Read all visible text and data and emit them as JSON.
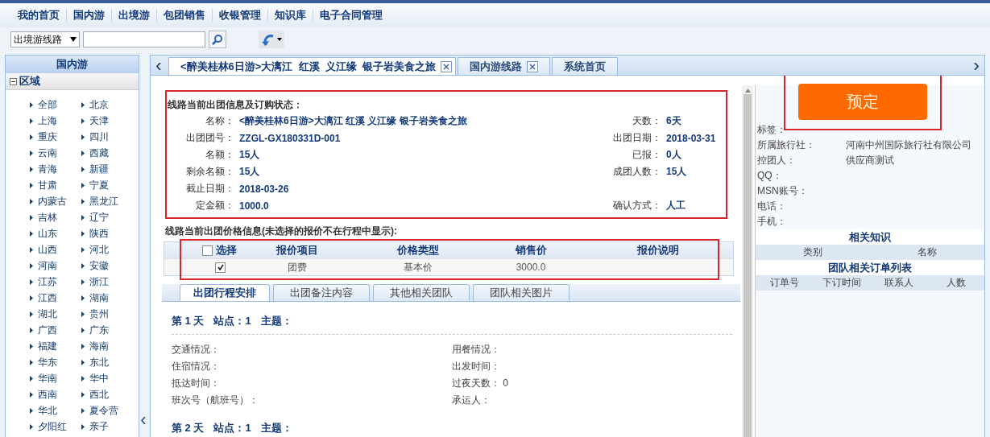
{
  "menu": [
    "我的首页",
    "国内游",
    "出境游",
    "包团销售",
    "收银管理",
    "知识库",
    "电子合同管理"
  ],
  "toolbar": {
    "select": "出境游线路"
  },
  "sidebar": {
    "title": "国内游",
    "section": {
      "label": "区域",
      "expanded": true
    },
    "items": [
      "全部",
      "北京",
      "上海",
      "天津",
      "重庆",
      "四川",
      "云南",
      "西藏",
      "青海",
      "新疆",
      "甘肃",
      "宁夏",
      "内蒙古",
      "黑龙江",
      "吉林",
      "辽宁",
      "山东",
      "陕西",
      "山西",
      "河北",
      "河南",
      "安徽",
      "江苏",
      "浙江",
      "江西",
      "湖南",
      "湖北",
      "贵州",
      "广西",
      "广东",
      "福建",
      "海南",
      "华东",
      "东北",
      "华南",
      "华中",
      "西南",
      "西北",
      "华北",
      "夏令营",
      "夕阳红",
      "亲子"
    ]
  },
  "tabs": [
    {
      "label": "<醉美桂林6日游>大漓江  红溪  义江缘  银子岩美食之旅",
      "selected": true,
      "closable": true
    },
    {
      "label": "国内游线路",
      "selected": false,
      "closable": true
    },
    {
      "label": "系统首页",
      "selected": false,
      "closable": false
    }
  ],
  "info": {
    "title": "线路当前出团信息及订购状态：",
    "rows": [
      {
        "left": {
          "label": "名称：",
          "value": "<醉美桂林6日游>大漓江 红溪 义江缘 银子岩美食之旅"
        },
        "right": {
          "label": "天数：",
          "value": "6天"
        }
      },
      {
        "left": {
          "label": "出团团号：",
          "value": "ZZGL-GX180331D-001"
        },
        "right": {
          "label": "出团日期：",
          "value": "2018-03-31"
        }
      },
      {
        "left": {
          "label": "名额：",
          "value": "15人"
        },
        "right": {
          "label": "已报：",
          "value": "0人"
        }
      },
      {
        "left": {
          "label": "剩余名额：",
          "value": "15人"
        },
        "right": {
          "label": "成团人数：",
          "value": "15人"
        }
      },
      {
        "left": {
          "label": "截止日期：",
          "value": "2018-03-26"
        }
      },
      {
        "left": {
          "label": "定金额：",
          "value": "1000.0"
        },
        "right": {
          "label": "确认方式：",
          "value": "人工"
        }
      }
    ]
  },
  "prices": {
    "title": "线路当前出团价格信息(未选择的报价不在行程中显示):",
    "select_all_checked": false,
    "columns": [
      "选择",
      "报价项目",
      "价格类型",
      "销售价",
      "报价说明"
    ],
    "rows": [
      {
        "checked": true,
        "cells": [
          "",
          "团费",
          "基本价",
          "3000.0"
        ]
      }
    ]
  },
  "detail_tabs": [
    {
      "label": "出团行程安排",
      "selected": true
    },
    {
      "label": "出团备注内容",
      "selected": false
    },
    {
      "label": "其他相关团队",
      "selected": false
    },
    {
      "label": "团队相关图片",
      "selected": false
    }
  ],
  "days": [
    {
      "day": "第 1 天",
      "station": "站点：1",
      "theme": "主题：",
      "fields": [
        {
          "label": "交通情况："
        },
        {
          "label": "用餐情况："
        },
        {
          "label": "住宿情况："
        },
        {
          "label": "出发时间："
        },
        {
          "label": "抵达时间："
        },
        {
          "label": "过夜天数：",
          "value": "0"
        },
        {
          "label": "班次号（航班号）："
        },
        {
          "label": "承运人："
        }
      ]
    },
    {
      "day": "第 2 天",
      "station": "站点：1",
      "theme": "主题："
    }
  ],
  "side": {
    "book_button": "预定",
    "contacts": [
      {
        "label": "标签："
      },
      {
        "label": "所属旅行社：",
        "value": "河南中州国际旅行社有限公司"
      },
      {
        "label": "控团人：",
        "value": "供应商测试"
      },
      {
        "label": "QQ："
      },
      {
        "label": "MSN账号："
      },
      {
        "label": "电话："
      },
      {
        "label": "手机："
      }
    ],
    "knowledge": {
      "title": "相关知识",
      "columns": [
        "类别",
        "名称"
      ]
    },
    "orders": {
      "title": "团队相关订单列表",
      "columns": [
        "订单号",
        "下订时间",
        "联系人",
        "人数"
      ]
    }
  }
}
